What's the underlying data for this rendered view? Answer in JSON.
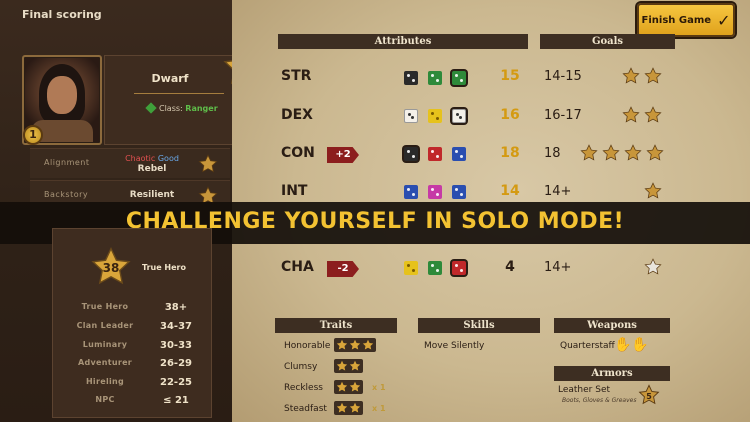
{
  "screen_title": "Final scoring",
  "finish_button": {
    "label": "Finish Game",
    "icon": "check-icon"
  },
  "character": {
    "level_badge": "1",
    "race": "Dwarf",
    "class_label": "Class:",
    "class_value": "Ranger",
    "score_star": "38",
    "alignment_label": "Alignment",
    "alignment_chaotic": "Chaotic",
    "alignment_good": "Good",
    "alignment_type": "Rebel",
    "backstory_label": "Backstory",
    "backstory_value": "Resilient"
  },
  "headers": {
    "attributes": "Attributes",
    "goals": "Goals",
    "traits": "Traits",
    "skills": "Skills",
    "weapons": "Weapons",
    "armors": "Armors"
  },
  "attributes": [
    {
      "name": "STR",
      "modifier": "",
      "score": "15",
      "goal": "14-15",
      "goal_stars": 2
    },
    {
      "name": "DEX",
      "modifier": "",
      "score": "16",
      "goal": "16-17",
      "goal_stars": 2
    },
    {
      "name": "CON",
      "modifier": "+2",
      "score": "18",
      "goal": "18",
      "goal_stars": 4
    },
    {
      "name": "INT",
      "modifier": "",
      "score": "14",
      "goal": "14+",
      "goal_stars": 1
    },
    {
      "name": "CHA",
      "modifier": "-2",
      "score": "4",
      "goal": "14+",
      "goal_stars": 0
    }
  ],
  "banner": "CHALLENGE YOURSELF IN SOLO MODE!",
  "rank": {
    "score": "38",
    "title": "True Hero",
    "tiers": [
      {
        "label": "True Hero",
        "range": "38+"
      },
      {
        "label": "Clan Leader",
        "range": "34-37"
      },
      {
        "label": "Luminary",
        "range": "30-33"
      },
      {
        "label": "Adventurer",
        "range": "26-29"
      },
      {
        "label": "Hireling",
        "range": "22-25"
      },
      {
        "label": "NPC",
        "range": "≤ 21"
      }
    ]
  },
  "traits": [
    {
      "label": "Honorable",
      "stars": 3,
      "mult": ""
    },
    {
      "label": "Clumsy",
      "stars": 2,
      "mult": ""
    },
    {
      "label": "Reckless",
      "stars": 2,
      "mult": "x 1"
    },
    {
      "label": "Steadfast",
      "stars": 2,
      "mult": "x 1"
    }
  ],
  "skills": [
    "Move Silently"
  ],
  "weapons": [
    "Quarterstaff"
  ],
  "armors": [
    {
      "name": "Leather Set",
      "pieces": "Boots, Gloves & Greaves",
      "value": "5"
    }
  ],
  "colors": {
    "gold": "#f3c232",
    "score_gold": "#d49a12",
    "parchment": "#d2c09c",
    "panel_dark": "#3d2e22",
    "modifier_red": "#8c1e1e"
  }
}
